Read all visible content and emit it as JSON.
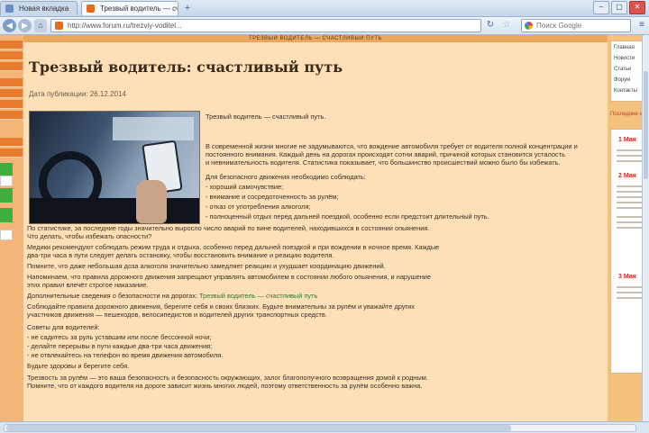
{
  "browser": {
    "tabs": [
      {
        "label": "Новая вкладка"
      },
      {
        "label": "Трезвый водитель — сч..."
      }
    ],
    "new_tab_symbol": "+",
    "window_controls": [
      "–",
      "▢",
      "✕"
    ],
    "url": "http://www.forum.ru/trezviy-voditel...",
    "search_placeholder": "Поиск Google",
    "nav_symbols": {
      "back": "◀",
      "forward": "▶",
      "home": "⌂",
      "reload": "↻",
      "star": "☆",
      "menu": "≡"
    }
  },
  "page": {
    "banner": "ТРЕЗВЫЙ ВОДИТЕЛЬ — СЧАСТЛИВЫЙ ПУТЬ",
    "title": "Трезвый водитель: счастливый путь",
    "date": "Дата публикации: 26.12.2014",
    "lead": "Трезвый водитель — счастливый путь.",
    "paragraphs": [
      "В современной жизни многие не задумываются, что вождение автомобиля требует от водителя полной концентрации и",
      "постоянного внимания. Каждый день на дорогах происходят сотни аварий, причиной которых становится усталость",
      "и невнимательность водителя. Статистика показывает, что большинство происшествий можно было бы избежать.",
      "Для безопасного движения необходимо соблюдать:",
      "- хороший самочувствие;",
      "- внимание и сосредоточенность за рулём;",
      "- отказ от употребления алкоголя;",
      "- полноценный отдых перед дальней поездкой, особенно если предстоит длительный путь.",
      "По статистике, за последние годы значительно выросло число аварий по вине водителей, находившихся в состоянии опьянения.",
      "Что делать, чтобы избежать опасности?",
      "Медики рекомендуют соблюдать режим труда и отдыха, особенно перед дальней поездкой и при вождении в ночное время. Каждые",
      "два-три часа в пути следует делать остановку, чтобы восстановить внимание и реакцию водителя.",
      "Помните, что даже небольшая доза алкоголя значительно замедляет реакцию и ухудшает координацию движений.",
      "Напоминаем, что правила дорожного движения запрещают управлять автомобилем в состоянии любого опьянения, и нарушение",
      "этих правил влечёт строгое наказание.",
      "Дополнительные сведения о безопасности на дорогах: ",
      "Соблюдайте правила дорожного движения, берегите себя и своих близких. Будьте внимательны за рулём и уважайте других",
      "участников движения — пешеходов, велосипедистов и водителей других транспортных средств.",
      "Советы для водителей:",
      "- не садитесь за руль уставшим или после бессонной ночи;",
      "- делайте перерывы в пути каждые два-три часа движения;",
      "- не отвлекайтесь на телефон во время движения автомобиля.",
      "Будьте здоровы и берегите себя.",
      "Трезвость за рулём — это ваша безопасность и безопасность окружающих, залог благополучного возвращения домой к родным.",
      "Помните, что от каждого водителя на дороге зависит жизнь многих людей, поэтому ответственность за рулём особенно важна."
    ],
    "inline_link": "Трезвый водитель — счастливый путь"
  },
  "sidebar_right": {
    "items": [
      "Главная",
      "Новости",
      "Статьи",
      "Форум",
      "Контакты"
    ],
    "ad_heading": "Последние новости",
    "ad_labels": [
      "1 Мая",
      "2 Мая",
      "3 Мая"
    ]
  },
  "colors": {
    "page_bg": "#f7c988",
    "article_bg": "#fde0b8",
    "accent_orange": "#e87c2e",
    "link_green": "#2a7a2a"
  }
}
